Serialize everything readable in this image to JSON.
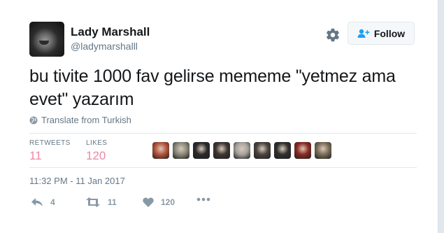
{
  "user": {
    "name": "Lady Marshall",
    "handle": "@ladymarshalll"
  },
  "follow_button": {
    "label": "Follow"
  },
  "tweet": {
    "text": "bu tivite 1000 fav gelirse mememe \"yetmez ama evet\" yazarım",
    "translate_label": "Translate from Turkish",
    "timestamp": "11:32 PM - 11 Jan 2017"
  },
  "stats": {
    "retweets_label": "RETWEETS",
    "retweets_value": "11",
    "likes_label": "LIKES",
    "likes_value": "120"
  },
  "likers": [
    {
      "icon": "avatar-red-face",
      "color": "#b5533b"
    },
    {
      "icon": "avatar-gray-figure",
      "color": "#8a8a7a"
    },
    {
      "icon": "avatar-dark-sunglasses",
      "color": "#2a2a2a"
    },
    {
      "icon": "avatar-dark-portrait",
      "color": "#3e3533"
    },
    {
      "icon": "avatar-light-portrait",
      "color": "#a7a39e"
    },
    {
      "icon": "avatar-dark-portrait-2",
      "color": "#4c4440"
    },
    {
      "icon": "avatar-black-white",
      "color": "#2f2f2f"
    },
    {
      "icon": "avatar-red-figure",
      "color": "#8b2a22"
    },
    {
      "icon": "avatar-olive-portrait",
      "color": "#7a6e58"
    }
  ],
  "actions": {
    "reply_count": "4",
    "retweet_count": "11",
    "like_count": "120"
  },
  "colors": {
    "like_accent": "#e0245e",
    "muted": "#657786",
    "follow_icon": "#1da1f2"
  }
}
